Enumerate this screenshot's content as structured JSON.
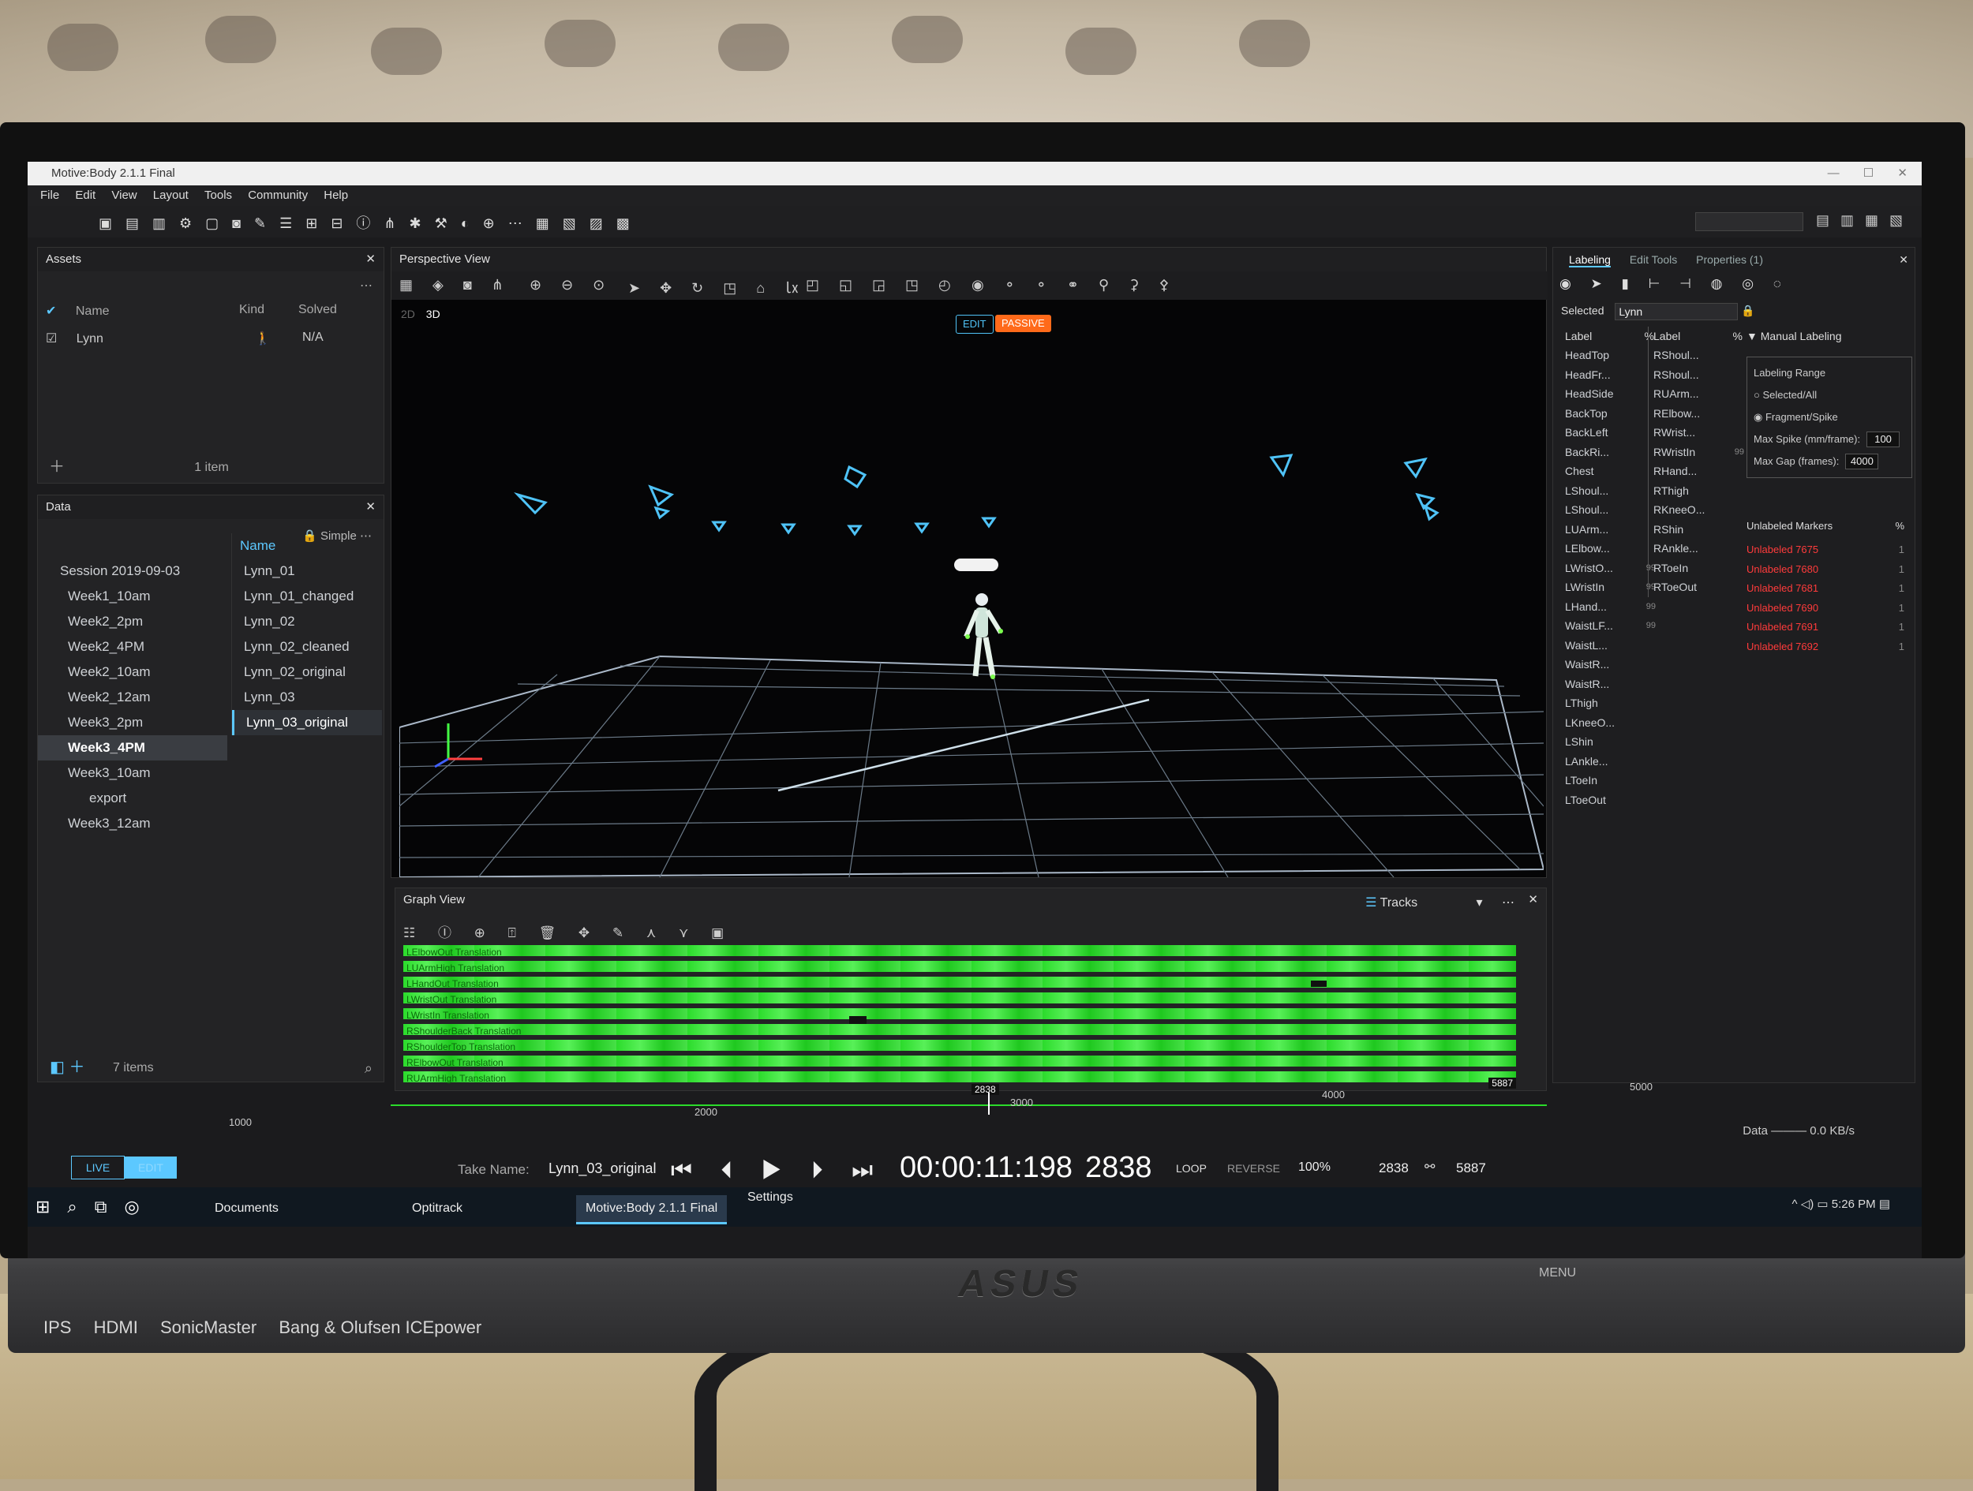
{
  "app": {
    "title": "Motive:Body 2.1.1 Final"
  },
  "menu": [
    "File",
    "Edit",
    "View",
    "Layout",
    "Tools",
    "Community",
    "Help"
  ],
  "assets": {
    "title": "Assets",
    "col_name": "Name",
    "col_kind": "Kind",
    "col_solved": "Solved",
    "row": {
      "name": "Lynn",
      "solved": "N/A"
    },
    "count": "1 item"
  },
  "data_panel": {
    "title": "Data",
    "mode": "Simple",
    "sessions": [
      "Session 2019-09-03",
      "Week1_10am",
      "Week2_2pm",
      "Week2_4PM",
      "Week2_10am",
      "Week2_12am",
      "Week3_2pm",
      "Week3_4PM",
      "Week3_10am",
      "export",
      "Week3_12am"
    ],
    "selected_session": "Week3_4PM",
    "takes_header": "Name",
    "takes": [
      "Lynn_01",
      "Lynn_01_changed",
      "Lynn_02",
      "Lynn_02_cleaned",
      "Lynn_02_original",
      "Lynn_03",
      "Lynn_03_original"
    ],
    "selected_take": "Lynn_03_original",
    "count": "7 items"
  },
  "perspective": {
    "title": "Perspective View",
    "mode_2d": "2D",
    "mode_3d": "3D",
    "badge_edit": "EDIT",
    "badge_passive": "PASSIVE"
  },
  "graph": {
    "title": "Graph View",
    "tracks_label": "Tracks",
    "track_names": [
      "LElbowOut Translation",
      "LUArmHigh Translation",
      "LHandOut Translation",
      "LWristOut Translation",
      "LWristIn Translation",
      "RShoulderBack Translation",
      "RShoulderTop Translation",
      "RElbowOut Translation",
      "RUArmHigh Translation"
    ],
    "range_start": "2838",
    "range_end": "5887"
  },
  "labeling": {
    "tabs": [
      "Labeling",
      "Edit Tools",
      "Properties (1)"
    ],
    "selected_label": "Selected",
    "selected_value": "Lynn",
    "col_label": "Label",
    "col_pct": "%",
    "left_labels": [
      {
        "n": "HeadTop",
        "p": ""
      },
      {
        "n": "HeadFr...",
        "p": ""
      },
      {
        "n": "HeadSide",
        "p": ""
      },
      {
        "n": "BackTop",
        "p": ""
      },
      {
        "n": "BackLeft",
        "p": ""
      },
      {
        "n": "BackRi...",
        "p": ""
      },
      {
        "n": "Chest",
        "p": ""
      },
      {
        "n": "LShoul...",
        "p": ""
      },
      {
        "n": "LShoul...",
        "p": ""
      },
      {
        "n": "LUArm...",
        "p": ""
      },
      {
        "n": "LElbow...",
        "p": ""
      },
      {
        "n": "LWristO...",
        "p": "99"
      },
      {
        "n": "LWristIn",
        "p": "99"
      },
      {
        "n": "LHand...",
        "p": "99"
      },
      {
        "n": "WaistLF...",
        "p": "99"
      },
      {
        "n": "WaistL...",
        "p": ""
      },
      {
        "n": "WaistR...",
        "p": ""
      },
      {
        "n": "WaistR...",
        "p": ""
      },
      {
        "n": "LThigh",
        "p": ""
      },
      {
        "n": "LKneeO...",
        "p": ""
      },
      {
        "n": "LShin",
        "p": ""
      },
      {
        "n": "LAnkle...",
        "p": ""
      },
      {
        "n": "LToeIn",
        "p": ""
      },
      {
        "n": "LToeOut",
        "p": ""
      }
    ],
    "right_labels": [
      {
        "n": "RShoul...",
        "p": ""
      },
      {
        "n": "RShoul...",
        "p": ""
      },
      {
        "n": "RUArm...",
        "p": ""
      },
      {
        "n": "RElbow...",
        "p": ""
      },
      {
        "n": "RWrist...",
        "p": ""
      },
      {
        "n": "RWristIn",
        "p": "99"
      },
      {
        "n": "RHand...",
        "p": ""
      },
      {
        "n": "RThigh",
        "p": ""
      },
      {
        "n": "RKneeO...",
        "p": ""
      },
      {
        "n": "RShin",
        "p": ""
      },
      {
        "n": "RAnkle...",
        "p": ""
      },
      {
        "n": "RToeIn",
        "p": ""
      },
      {
        "n": "RToeOut",
        "p": ""
      }
    ],
    "manual": {
      "title": "Manual Labeling",
      "range_title": "Labeling Range",
      "opt1": "Selected/All",
      "opt2": "Fragment/Spike",
      "max_spike_label": "Max Spike (mm/frame):",
      "max_spike": "100",
      "max_gap_label": "Max Gap (frames):",
      "max_gap": "4000"
    },
    "unlabeled": {
      "title": "Unlabeled Markers",
      "pct": "%",
      "items": [
        {
          "n": "Unlabeled 7675",
          "v": "1"
        },
        {
          "n": "Unlabeled 7680",
          "v": "1"
        },
        {
          "n": "Unlabeled 7681",
          "v": "1"
        },
        {
          "n": "Unlabeled 7690",
          "v": "1"
        },
        {
          "n": "Unlabeled 7691",
          "v": "1"
        },
        {
          "n": "Unlabeled 7692",
          "v": "1"
        }
      ]
    }
  },
  "timeline": {
    "ticks": [
      "1000",
      "2000",
      "3000",
      "4000",
      "5000"
    ]
  },
  "transport": {
    "take_name_label": "Take Name:",
    "take_name": "Lynn_03_original",
    "timecode": "00:00:11:198",
    "frame": "2838",
    "loop": "LOOP",
    "reverse": "REVERSE",
    "speed": "100%",
    "current": "2838",
    "end": "5887"
  },
  "mode": {
    "live": "LIVE",
    "edit": "EDIT"
  },
  "status": {
    "data_label": "Data",
    "data_rate": "0.0 KB/s"
  },
  "taskbar": {
    "items": [
      "Documents",
      "Optitrack",
      "Motive:Body 2.1.1 Final",
      "Settings"
    ],
    "time": "5:26 PM"
  },
  "hardware": {
    "brand": "ASUS",
    "badges": [
      "IPS",
      "HDMI",
      "SonicMaster",
      "Bang & Olufsen ICEpower"
    ],
    "buttons": [
      "MENU"
    ]
  },
  "colors": {
    "accent": "#5cc8ff",
    "passive": "#ff6a1a",
    "unlabeled": "#ff3b3b",
    "track": "#2bdb2b"
  }
}
